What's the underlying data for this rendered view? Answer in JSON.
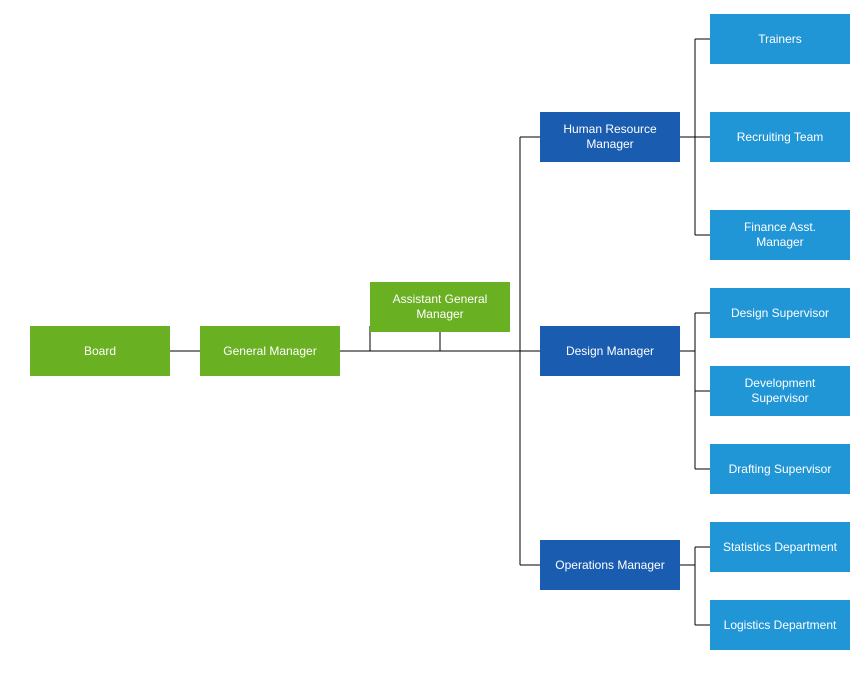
{
  "org": {
    "board": "Board",
    "general_manager": "General Manager",
    "assistant_general_manager": "Assistant General\nManager",
    "hr_manager": "Human Resource\nManager",
    "design_manager": "Design Manager",
    "operations_manager": "Operations Manager",
    "hr_children": {
      "trainers": "Trainers",
      "recruiting_team": "Recruiting Team",
      "finance_asst_manager": "Finance Asst.\nManager"
    },
    "design_children": {
      "design_supervisor": "Design Supervisor",
      "development_supervisor": "Development\nSupervisor",
      "drafting_supervisor": "Drafting Supervisor"
    },
    "ops_children": {
      "statistics_department": "Statistics Department",
      "logistics_department": "Logistics Department"
    }
  },
  "colors": {
    "green": "#6ab023",
    "darkblue": "#1a5cb0",
    "lightblue": "#2196d6"
  }
}
